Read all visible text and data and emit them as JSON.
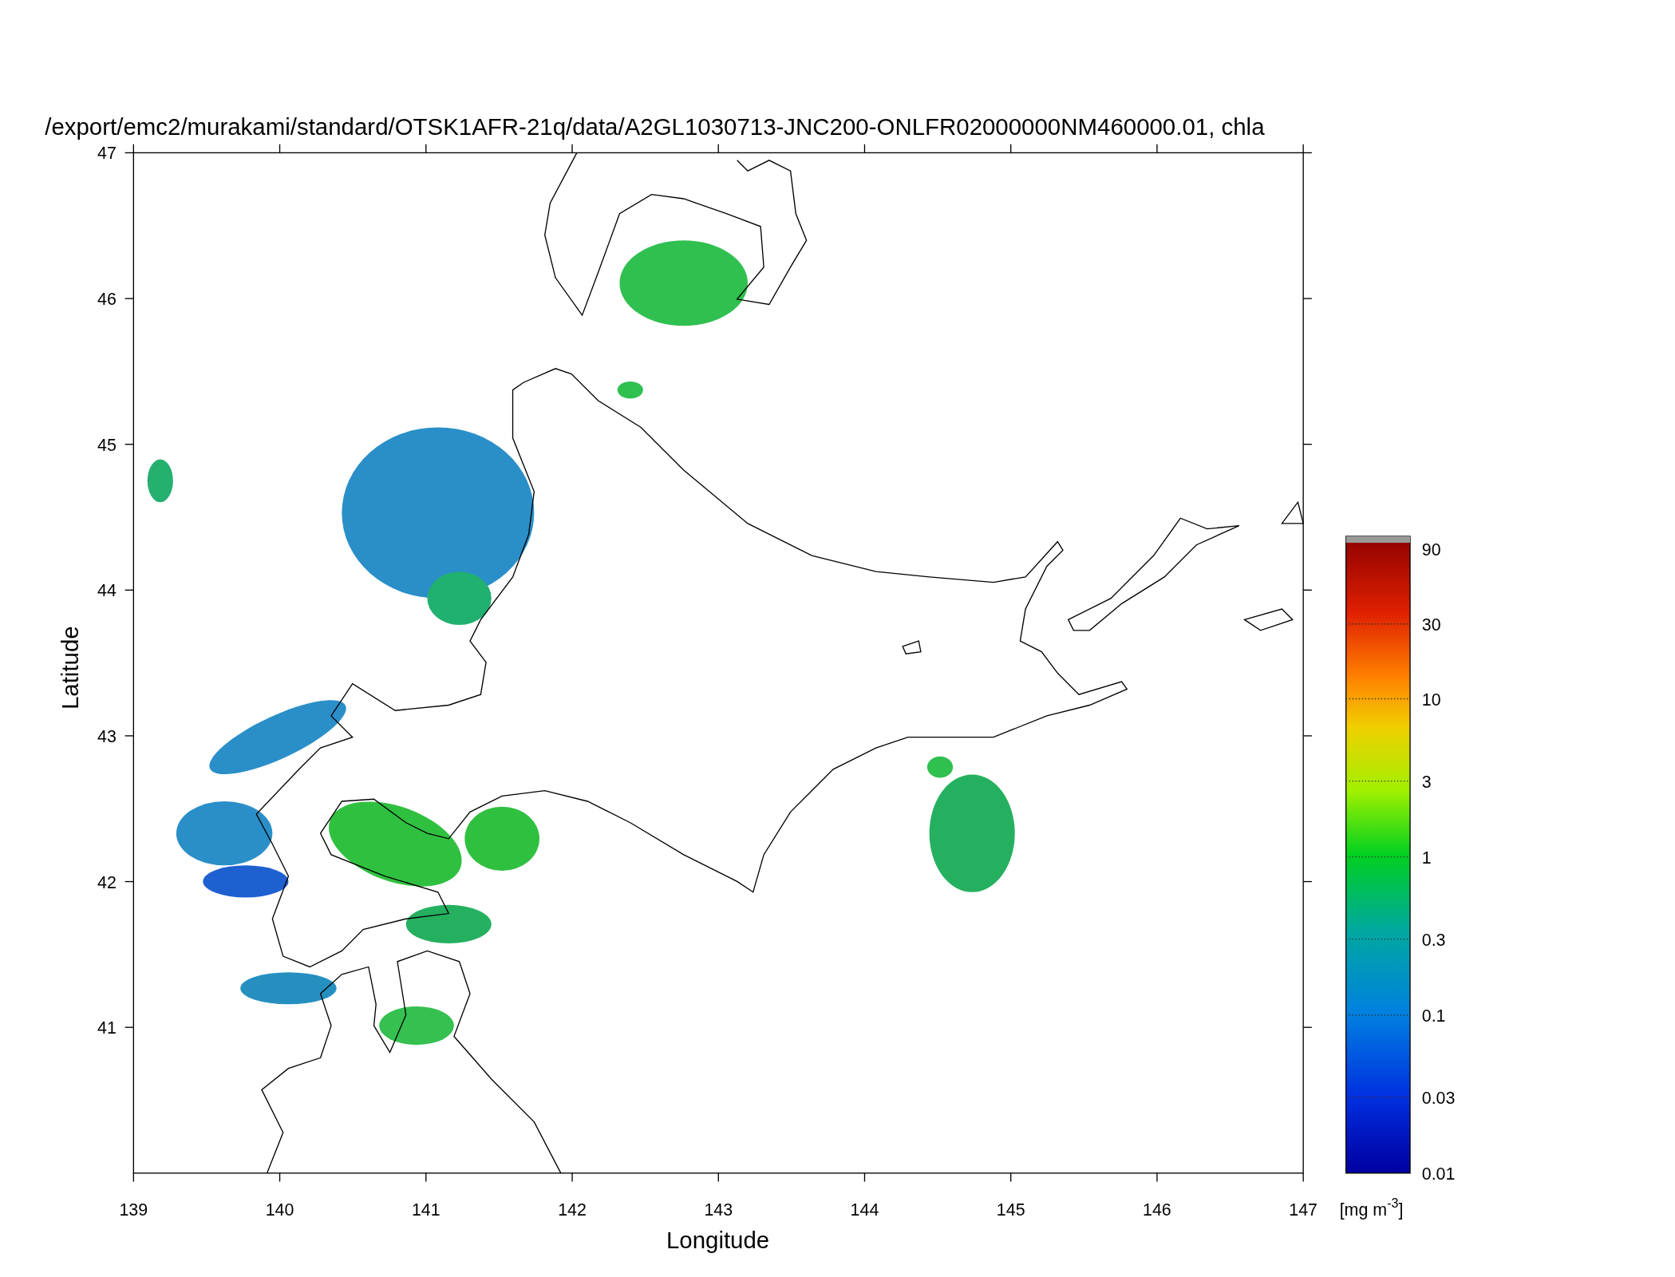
{
  "title": "/export/emc2/murakami/standard/OTSK1AFR-21q/data/A2GL1030713-JNC200-ONLFR02000000NM460000.01, chla",
  "y_axis": {
    "label": "Latitude",
    "ticks": [
      "47",
      "46",
      "45",
      "44",
      "43",
      "42",
      "41"
    ]
  },
  "x_axis": {
    "label": "Longitude",
    "ticks": [
      "139",
      "140",
      "141",
      "142",
      "143",
      "144",
      "145",
      "146",
      "147"
    ]
  },
  "colorbar": {
    "ticks": [
      "90",
      "30",
      "10",
      "3",
      "1",
      "0.3",
      "0.1",
      "0.03",
      "0.01"
    ],
    "unit_base": "[mg m",
    "unit_exponent": "-3",
    "unit_close": "]"
  }
}
